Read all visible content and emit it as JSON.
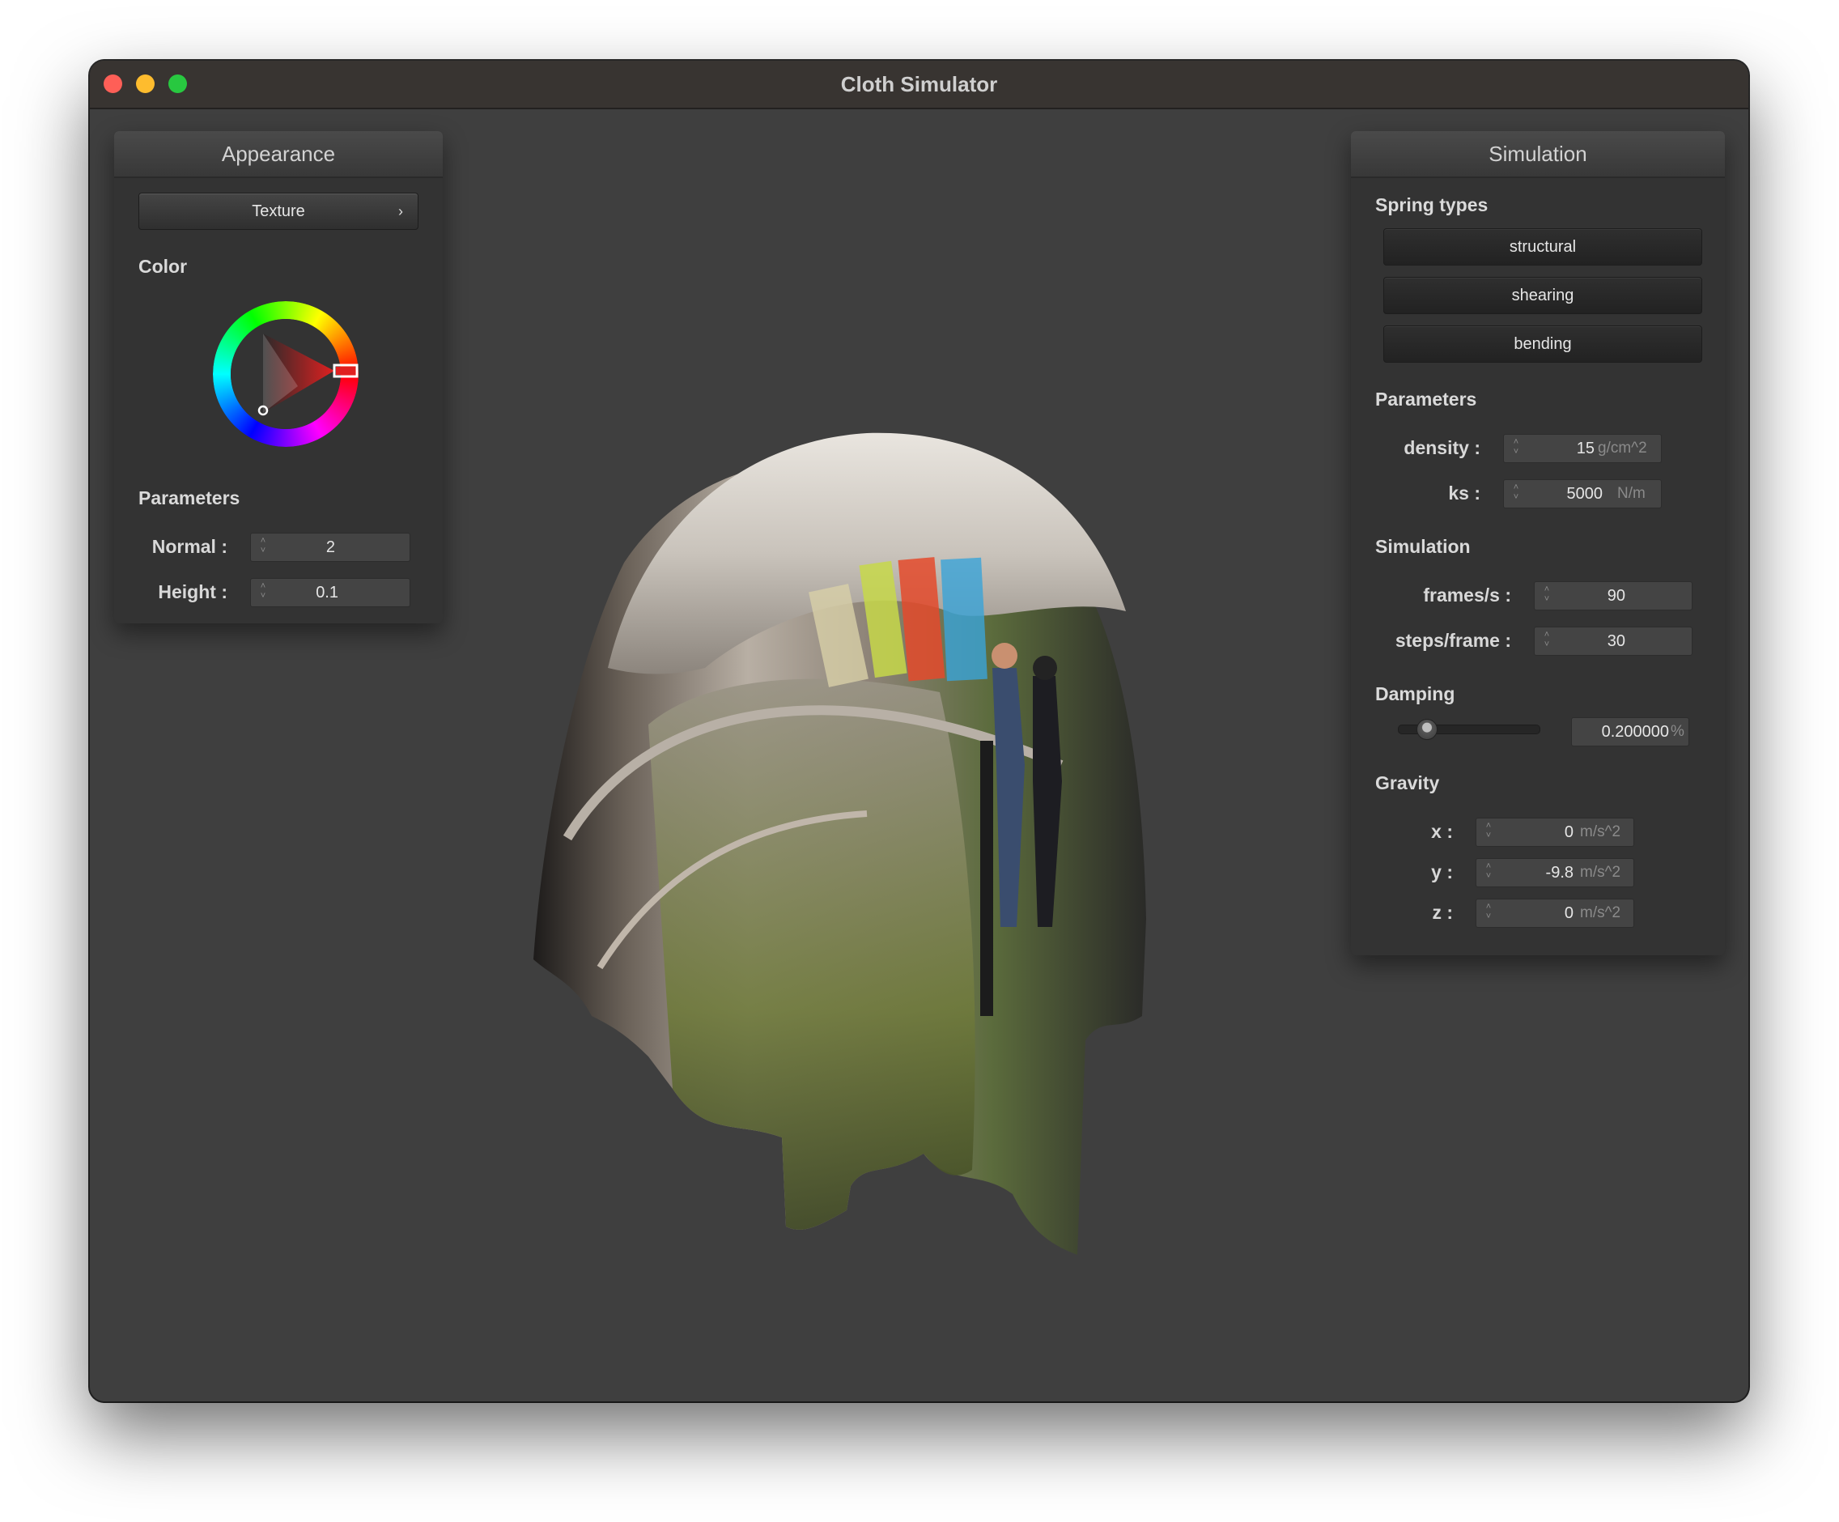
{
  "window": {
    "title": "Cloth Simulator"
  },
  "appearance": {
    "header": "Appearance",
    "texture_button": "Texture",
    "color_label": "Color",
    "color_value": "#e02020",
    "parameters_label": "Parameters",
    "normal": {
      "label": "Normal :",
      "value": "2"
    },
    "height": {
      "label": "Height :",
      "value": "0.1"
    }
  },
  "simulation": {
    "header": "Simulation",
    "spring_types_label": "Spring types",
    "spring_buttons": [
      "structural",
      "shearing",
      "bending"
    ],
    "parameters_label": "Parameters",
    "density": {
      "label": "density :",
      "value": "15",
      "unit": "g/cm^2"
    },
    "ks": {
      "label": "ks :",
      "value": "5000",
      "unit": "N/m"
    },
    "simulation_label": "Simulation",
    "fps": {
      "label": "frames/s :",
      "value": "90"
    },
    "steps": {
      "label": "steps/frame :",
      "value": "30"
    },
    "damping_label": "Damping",
    "damping": {
      "value": "0.200000",
      "unit": "%",
      "level": 0.2
    },
    "gravity_label": "Gravity",
    "gravity_x": {
      "label": "x :",
      "value": "0",
      "unit": "m/s^2"
    },
    "gravity_y": {
      "label": "y :",
      "value": "-9.8",
      "unit": "m/s^2"
    },
    "gravity_z": {
      "label": "z :",
      "value": "0",
      "unit": "m/s^2"
    }
  }
}
